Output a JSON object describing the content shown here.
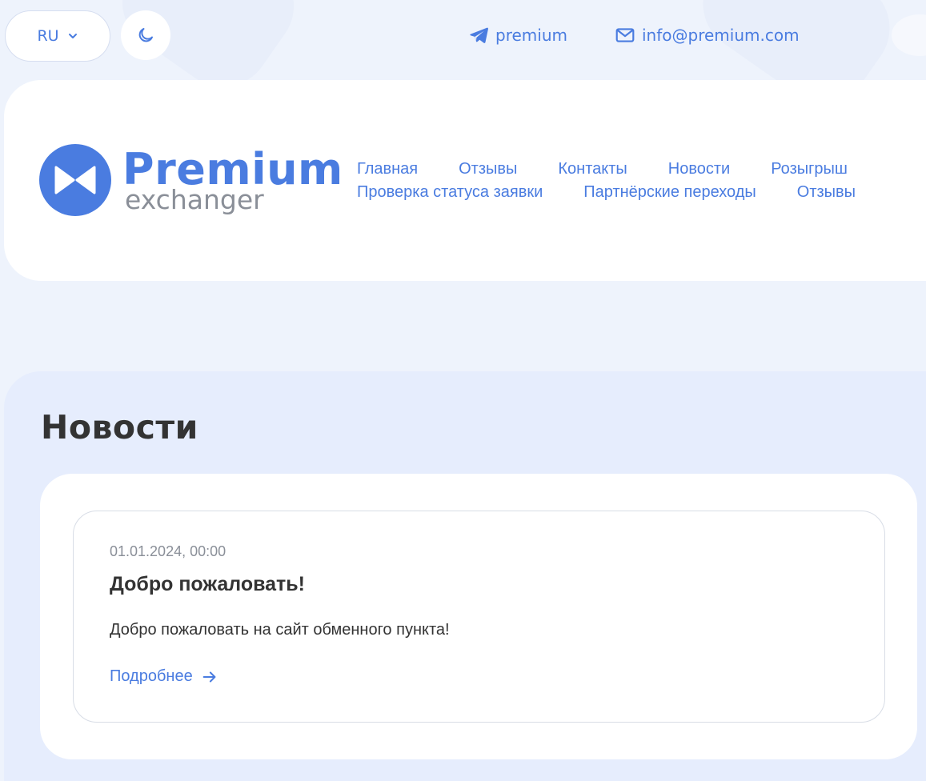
{
  "topbar": {
    "language": "RU",
    "telegram_label": "premium",
    "email_label": "info@premium.com"
  },
  "logo": {
    "title": "Premium",
    "subtitle": "exchanger"
  },
  "nav": {
    "row1": [
      "Главная",
      "Отзывы",
      "Контакты",
      "Новости",
      "Розыгрыш"
    ],
    "row2": [
      "Проверка статуса заявки",
      "Партнёрские переходы",
      "Отзывы"
    ]
  },
  "news": {
    "section_title": "Новости",
    "items": [
      {
        "date": "01.01.2024, 00:00",
        "title": "Добро пожаловать!",
        "text": "Добро пожаловать на сайт обменного пункта!",
        "more": "Подробнее"
      }
    ]
  },
  "colors": {
    "accent": "#4a7ce0",
    "background": "#eef3fc",
    "section_bg": "#e6edfd",
    "text": "#333333",
    "muted": "#8a8f98"
  },
  "icons": {
    "language_dropdown": "chevron-down-icon",
    "theme": "moon-icon",
    "telegram": "telegram-icon",
    "email": "mail-icon",
    "more": "arrow-right-icon"
  }
}
